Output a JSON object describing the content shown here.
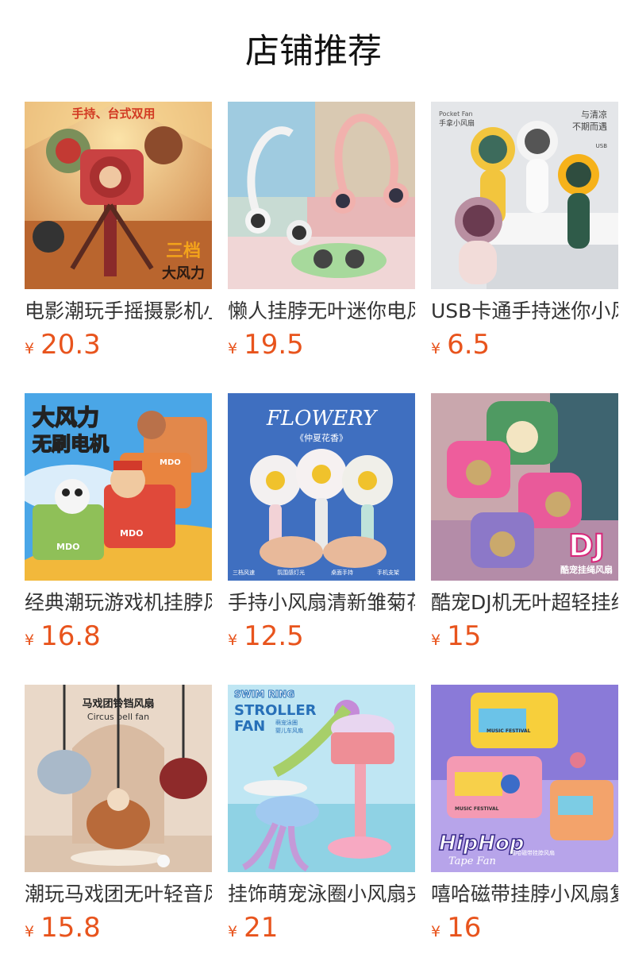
{
  "header": {
    "title": "店铺推荐"
  },
  "currency_symbol": "¥",
  "products": [
    {
      "name": "电影潮玩手摇摄影机小风扇",
      "price": "20.3",
      "image_text": [
        "手持、台式双用",
        "三档",
        "大风力"
      ]
    },
    {
      "name": "懒人挂脖无叶迷你电风扇",
      "price": "19.5",
      "image_text": []
    },
    {
      "name": "USB卡通手持迷你小风扇",
      "price": "6.5",
      "image_text": [
        "Pocket Fan",
        "手拿小风扇",
        "与清凉",
        "不期而遇",
        "USB"
      ]
    },
    {
      "name": "经典潮玩游戏机挂脖风扇",
      "price": "16.8",
      "image_text": [
        "大风力",
        "无刷电机",
        "MDO",
        "MDO",
        "MDO"
      ]
    },
    {
      "name": "手持小风扇清新雏菊花朵",
      "price": "12.5",
      "image_text": [
        "FLOWERY",
        "《仲夏花香》",
        "三档风速",
        "氛围感灯光",
        "桌面手持",
        "手机支架"
      ]
    },
    {
      "name": "酷宠DJ机无叶超轻挂绳风扇",
      "price": "15",
      "image_text": [
        "DJ",
        "酷宠挂绳风扇"
      ]
    },
    {
      "name": "潮玩马戏团无叶轻音风扇",
      "price": "15.8",
      "image_text": [
        "马戏团铃铛风扇",
        "Circus bell fan"
      ]
    },
    {
      "name": "挂饰萌宠泳圈小风扇夹",
      "price": "21",
      "image_text": [
        "SWIM RING",
        "STROLLER",
        "FAN",
        "萌宠泳圈",
        "婴儿车风扇"
      ]
    },
    {
      "name": "嘻哈磁带挂脖小风扇复古",
      "price": "16",
      "image_text": [
        "HipHop",
        "Tape Fan",
        "MUSIC FESTIVAL",
        "MUSIC FESTIVAL",
        "嘻哈磁带挂脖风扇"
      ]
    }
  ],
  "colors": {
    "price": "#e8541d",
    "title": "#111111",
    "name": "#333333"
  }
}
